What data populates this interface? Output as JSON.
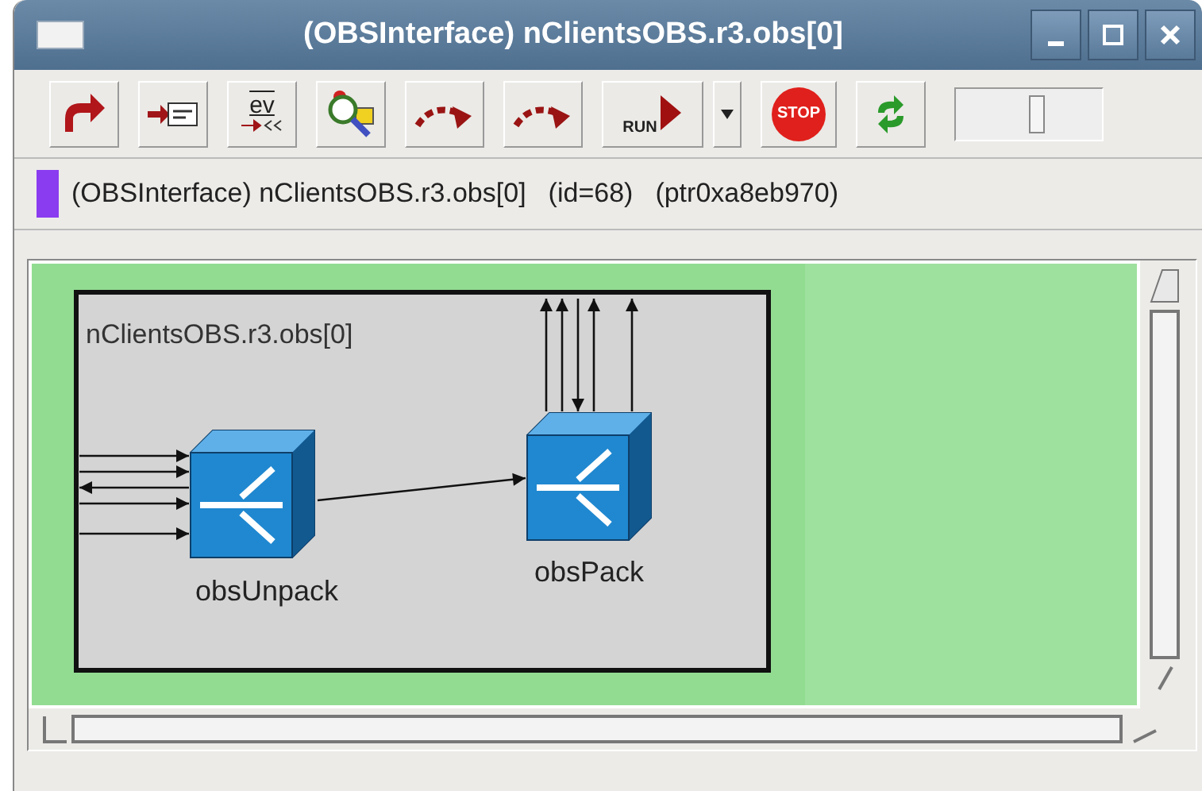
{
  "window": {
    "title": "(OBSInterface) nClientsOBS.r3.obs[0]"
  },
  "toolbar": {
    "buttons": [
      {
        "kind": "up"
      },
      {
        "kind": "fields"
      },
      {
        "kind": "events",
        "label": "ev"
      },
      {
        "kind": "find"
      },
      {
        "kind": "step"
      },
      {
        "kind": "step"
      },
      {
        "kind": "run",
        "label": "RUN"
      },
      {
        "kind": "dropdown"
      },
      {
        "kind": "stop",
        "label": "STOP"
      },
      {
        "kind": "refresh"
      }
    ],
    "speed_slider": {
      "level": 0.55
    }
  },
  "info_bar": {
    "color": "#8a3cf0",
    "texts": [
      "(OBSInterface) nClientsOBS.r3.obs[0]",
      "(id=68)",
      "(ptr0xa8eb970)"
    ]
  },
  "diagram": {
    "compound_name": "nClientsOBS.r3.obs[0]",
    "modules": [
      {
        "name": "obsUnpack"
      },
      {
        "name": "obsPack"
      }
    ]
  }
}
